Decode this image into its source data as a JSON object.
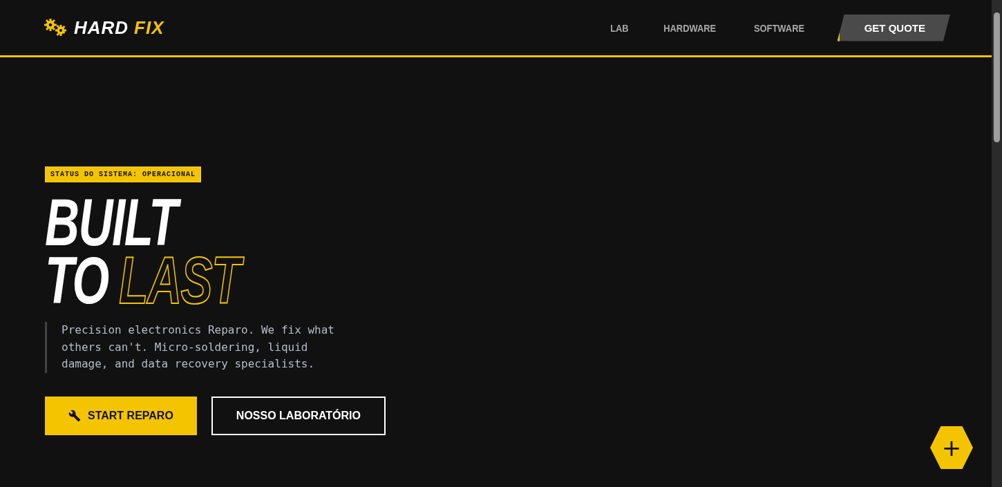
{
  "brand": {
    "parts": [
      {
        "text": "HARD",
        "kind": "plain"
      },
      {
        "text": "FIX",
        "kind": "accent"
      }
    ]
  },
  "nav": {
    "items": [
      {
        "label": "LAB",
        "kind": "link"
      },
      {
        "label": "HARDWARE",
        "kind": "link"
      },
      {
        "label": "SOFTWARE",
        "kind": "link"
      },
      {
        "label": "GET QUOTE",
        "kind": "cta"
      }
    ]
  },
  "hero": {
    "status_badge": "STATUS DO SISTEMA: OPERACIONAL",
    "headline": [
      [
        {
          "text": "BUILT",
          "kind": "solid"
        }
      ],
      [
        {
          "text": "TO",
          "kind": "solid"
        },
        {
          "text": "LAST",
          "kind": "outline"
        }
      ]
    ],
    "description": "Precision electronics Reparo. We fix what others can't. Micro-soldering, liquid damage, and data recovery specialists.",
    "buttons": [
      {
        "label": "START REPARO",
        "kind": "primary"
      },
      {
        "label": "NOSSO LABORATÓRIO",
        "kind": "secondary"
      }
    ]
  },
  "fab": {
    "label": "+"
  }
}
